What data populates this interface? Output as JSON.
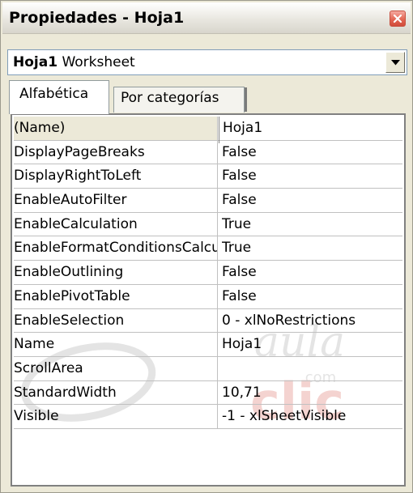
{
  "window": {
    "title": "Propiedades - Hoja1"
  },
  "object_selector": {
    "object_name": "Hoja1",
    "object_type": "Worksheet"
  },
  "tabs": [
    {
      "label": "Alfabética",
      "selected": true
    },
    {
      "label": "Por categorías",
      "selected": false
    }
  ],
  "properties": [
    {
      "name": "(Name)",
      "value": "Hoja1"
    },
    {
      "name": "DisplayPageBreaks",
      "value": "False"
    },
    {
      "name": "DisplayRightToLeft",
      "value": "False"
    },
    {
      "name": "EnableAutoFilter",
      "value": "False"
    },
    {
      "name": "EnableCalculation",
      "value": "True"
    },
    {
      "name": "EnableFormatConditionsCalculation",
      "value": "True"
    },
    {
      "name": "EnableOutlining",
      "value": "False"
    },
    {
      "name": "EnablePivotTable",
      "value": "False"
    },
    {
      "name": "EnableSelection",
      "value": "0 - xlNoRestrictions"
    },
    {
      "name": "Name",
      "value": "Hoja1"
    },
    {
      "name": "ScrollArea",
      "value": ""
    },
    {
      "name": "StandardWidth",
      "value": "10,71"
    },
    {
      "name": "Visible",
      "value": "-1 - xlSheetVisible"
    }
  ],
  "watermark": {
    "text_top": "aula",
    "text_small": ".com",
    "text_bottom": "clic"
  },
  "colors": {
    "close_button": "#e36654",
    "window_bg": "#ece9d8"
  }
}
